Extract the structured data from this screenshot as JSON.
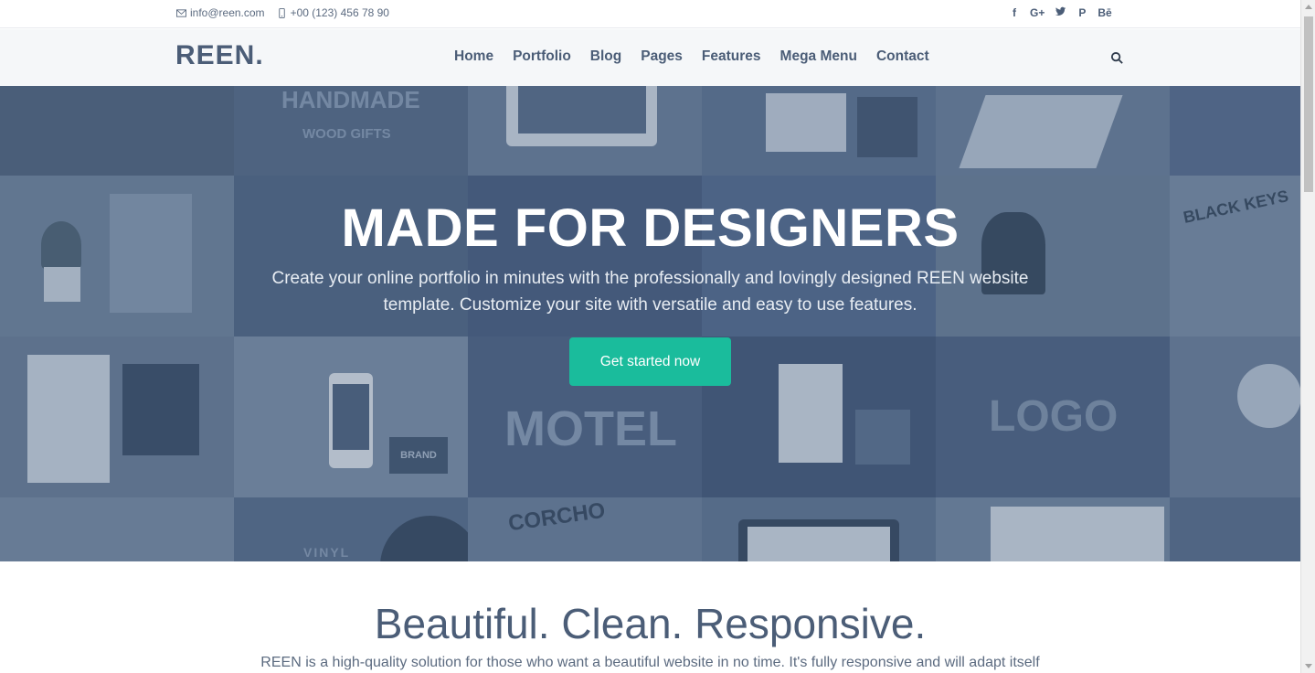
{
  "topbar": {
    "email": "info@reen.com",
    "phone": "+00 (123) 456 78 90",
    "social": [
      "f",
      "G+",
      "t",
      "P",
      "Bē"
    ]
  },
  "navbar": {
    "logo": "REEN.",
    "items": [
      "Home",
      "Portfolio",
      "Blog",
      "Pages",
      "Features",
      "Mega Menu",
      "Contact"
    ]
  },
  "hero": {
    "title": "MADE FOR DESIGNERS",
    "subtitle": "Create your online portfolio in minutes with the professionally and lovingly designed REEN website template. Customize your site with versatile and easy to use features.",
    "cta": "Get started now",
    "tile_texts": [
      "HANDMADE",
      "WOOD GIFTS",
      "MOTEL",
      "LOGO",
      "BLACK KEYS",
      "CORCHO",
      "VINYL",
      "BRAND"
    ]
  },
  "section": {
    "title": "Beautiful. Clean. Responsive.",
    "text": "REEN is a high-quality solution for those who want a beautiful website in no time. It's fully responsive and will adapt itself"
  },
  "colors": {
    "accent": "#1abc9c",
    "brand": "#4b5d77"
  }
}
